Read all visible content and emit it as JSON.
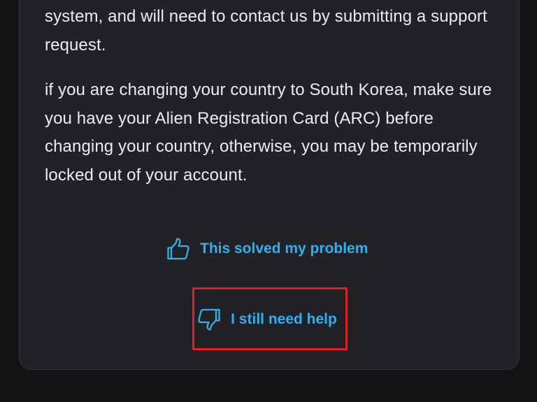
{
  "article": {
    "paragraph_1": "system, and will need to contact us by submitting a support request.",
    "paragraph_2": "if you are changing your country to South Korea, make sure you have your Alien Registration Card (ARC) before changing your country, otherwise, you may be temporarily locked out of your account."
  },
  "feedback": {
    "solved_label": "This solved my problem",
    "solved_icon": "thumbs-up-icon",
    "help_label": "I still need help",
    "help_icon": "thumbs-down-icon"
  },
  "colors": {
    "page_background": "#131316",
    "card_background": "#222226",
    "text": "#ececef",
    "accent": "#33aef0",
    "highlight": "#e0202a"
  }
}
